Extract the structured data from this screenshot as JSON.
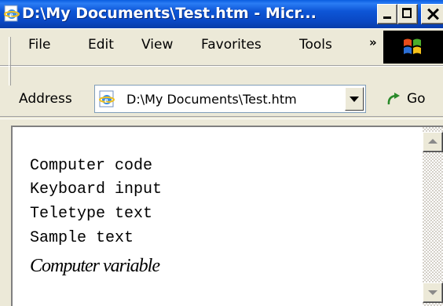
{
  "window": {
    "title": "D:\\My Documents\\Test.htm - Micr..."
  },
  "menu": {
    "items": [
      "File",
      "Edit",
      "View",
      "Favorites",
      "Tools"
    ],
    "overflow": "»"
  },
  "address_bar": {
    "label": "Address",
    "value": "D:\\My Documents\\Test.htm",
    "go_label": "Go"
  },
  "content": {
    "lines": [
      "Computer code",
      "Keyboard input",
      "Teletype text",
      "Sample text"
    ],
    "variable_line": "Computer variable"
  },
  "icons": {
    "app": "ie-page-icon",
    "address": "ie-page-icon",
    "go": "go-arrow-icon",
    "logo": "windows-logo-icon"
  },
  "colors": {
    "titlebar": "#0a48c4",
    "chrome": "#ece9d8"
  }
}
